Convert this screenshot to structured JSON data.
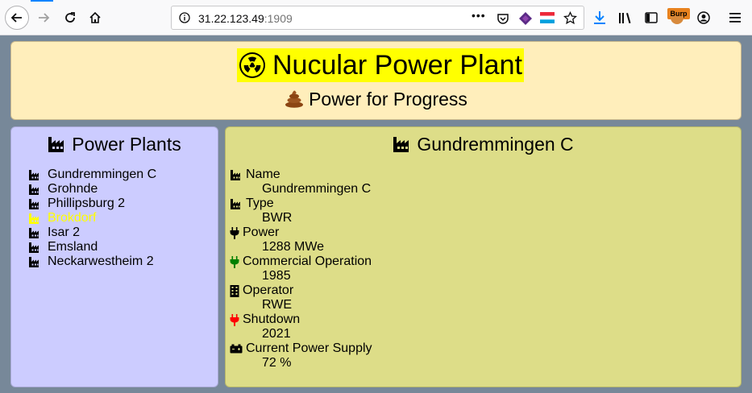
{
  "browser": {
    "url_host": "31.22.123.49",
    "url_port": ":1909",
    "burp_label": "Burp",
    "page_actions_label": "•••"
  },
  "header": {
    "title": "Nucular Power Plant",
    "subtitle": "Power for Progress",
    "title_icon": "radioactive-icon",
    "subtitle_icon": "poo-icon",
    "title_highlight": "#ffff00"
  },
  "sidebar": {
    "heading": "Power Plants",
    "heading_icon": "industry-icon",
    "items": [
      {
        "label": "Gundremmingen C",
        "active": false
      },
      {
        "label": "Grohnde",
        "active": false
      },
      {
        "label": "Phillipsburg 2",
        "active": false
      },
      {
        "label": "Brokdorf",
        "active": true
      },
      {
        "label": "Isar 2",
        "active": false
      },
      {
        "label": "Emsland",
        "active": false
      },
      {
        "label": "Neckarwestheim 2",
        "active": false
      }
    ]
  },
  "detail": {
    "heading": "Gundremmingen C",
    "fields": [
      {
        "label": "Name",
        "value": "Gundremmingen C",
        "icon": "industry-icon",
        "icon_color": "#000000"
      },
      {
        "label": "Type",
        "value": "BWR",
        "icon": "industry-icon",
        "icon_color": "#000000"
      },
      {
        "label": "Power",
        "value": "1288 MWe",
        "icon": "plug-icon",
        "icon_color": "#000000"
      },
      {
        "label": "Commercial Operation",
        "value": "1985",
        "icon": "plug-icon",
        "icon_color": "#008000"
      },
      {
        "label": "Operator",
        "value": "RWE",
        "icon": "building-icon",
        "icon_color": "#000000"
      },
      {
        "label": "Shutdown",
        "value": "2021",
        "icon": "plug-icon",
        "icon_color": "#ff0000"
      },
      {
        "label": "Current Power Supply",
        "value": "72 %",
        "icon": "battery-icon",
        "icon_color": "#000000"
      }
    ]
  },
  "colors": {
    "page_bg": "#778899",
    "header_bg": "#ffeebb",
    "sidebar_bg": "#ccccff",
    "detail_bg": "#dddd88",
    "active_item": "#ffff00"
  }
}
